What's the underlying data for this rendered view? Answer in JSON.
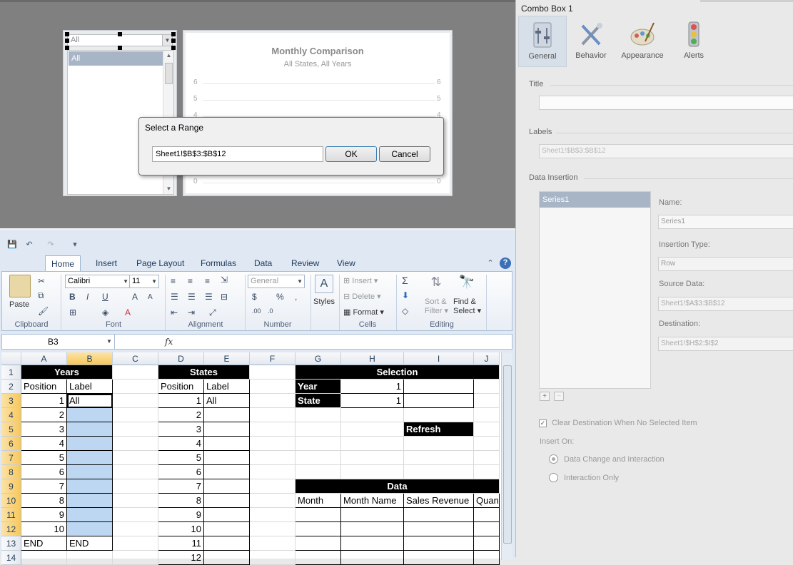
{
  "canvas": {
    "combo_selected": "All",
    "combo_list_item": "All",
    "chart": {
      "title": "Monthly Comparison",
      "subtitle": "All States, All Years",
      "left_ticks": [
        "6",
        "5",
        "4",
        "0"
      ],
      "right_ticks": [
        "6",
        "5",
        "4",
        "0"
      ]
    }
  },
  "dialog": {
    "title": "Select a Range",
    "range_value": "Sheet1!$B$3:$B$12",
    "ok_label": "OK",
    "cancel_label": "Cancel"
  },
  "props": {
    "title": "Combo Box 1",
    "tabs": [
      {
        "label": "General",
        "icon": "general-icon"
      },
      {
        "label": "Behavior",
        "icon": "behavior-icon"
      },
      {
        "label": "Appearance",
        "icon": "appearance-icon"
      },
      {
        "label": "Alerts",
        "icon": "alerts-icon"
      }
    ],
    "title_section": "Title",
    "title_value": "",
    "labels_section": "Labels",
    "labels_value": "Sheet1!$B$3:$B$12",
    "data_insertion_section": "Data Insertion",
    "series_item": "Series1",
    "name_label": "Name:",
    "name_value": "Series1",
    "insertion_type_label": "Insertion Type:",
    "insertion_type_value": "Row",
    "source_data_label": "Source Data:",
    "source_data_value": "Sheet1!$A$3:$B$12",
    "destination_label": "Destination:",
    "destination_value": "Sheet1!$H$2:$I$2",
    "clear_destination_label": "Clear Destination When No Selected Item",
    "insert_on_label": "Insert On:",
    "radio_change_interaction": "Data Change and Interaction",
    "radio_interaction_only": "Interaction Only"
  },
  "excel": {
    "ribbon_tabs": [
      "Home",
      "Insert",
      "Page Layout",
      "Formulas",
      "Data",
      "Review",
      "View"
    ],
    "clipboard": {
      "paste": "Paste",
      "label": "Clipboard"
    },
    "font": {
      "name": "Calibri",
      "size": "11",
      "label": "Font"
    },
    "alignment_label": "Alignment",
    "number": {
      "format": "General",
      "label": "Number"
    },
    "styles_label": "Styles",
    "cells": {
      "insert": "Insert",
      "delete": "Delete",
      "format": "Format",
      "label": "Cells"
    },
    "editing": {
      "sort1": "Sort &",
      "sort2": "Filter",
      "find1": "Find &",
      "find2": "Select",
      "label": "Editing"
    },
    "name_box": "B3",
    "fx": "fx",
    "columns": [
      "A",
      "B",
      "C",
      "D",
      "E",
      "F",
      "G",
      "H",
      "I",
      "J"
    ],
    "rows": [
      "1",
      "2",
      "3",
      "4",
      "5",
      "6",
      "7",
      "8",
      "9",
      "10",
      "11",
      "12",
      "13",
      "14"
    ],
    "cells_data": {
      "years_header": "Years",
      "states_header": "States",
      "selection_header": "Selection",
      "data_header": "Data",
      "position": "Position",
      "label": "Label",
      "a_values": [
        "1",
        "2",
        "3",
        "4",
        "5",
        "6",
        "7",
        "8",
        "9",
        "10"
      ],
      "b3": "All",
      "end": "END",
      "d_values": [
        "1",
        "2",
        "3",
        "4",
        "5",
        "6",
        "7",
        "8",
        "9",
        "10",
        "11",
        "12"
      ],
      "e3": "All",
      "year": "Year",
      "state": "State",
      "h2": "1",
      "h3": "1",
      "refresh": "Refresh",
      "month": "Month",
      "month_name": "Month Name",
      "sales_revenue": "Sales Revenue",
      "quantity": "Quan"
    }
  }
}
